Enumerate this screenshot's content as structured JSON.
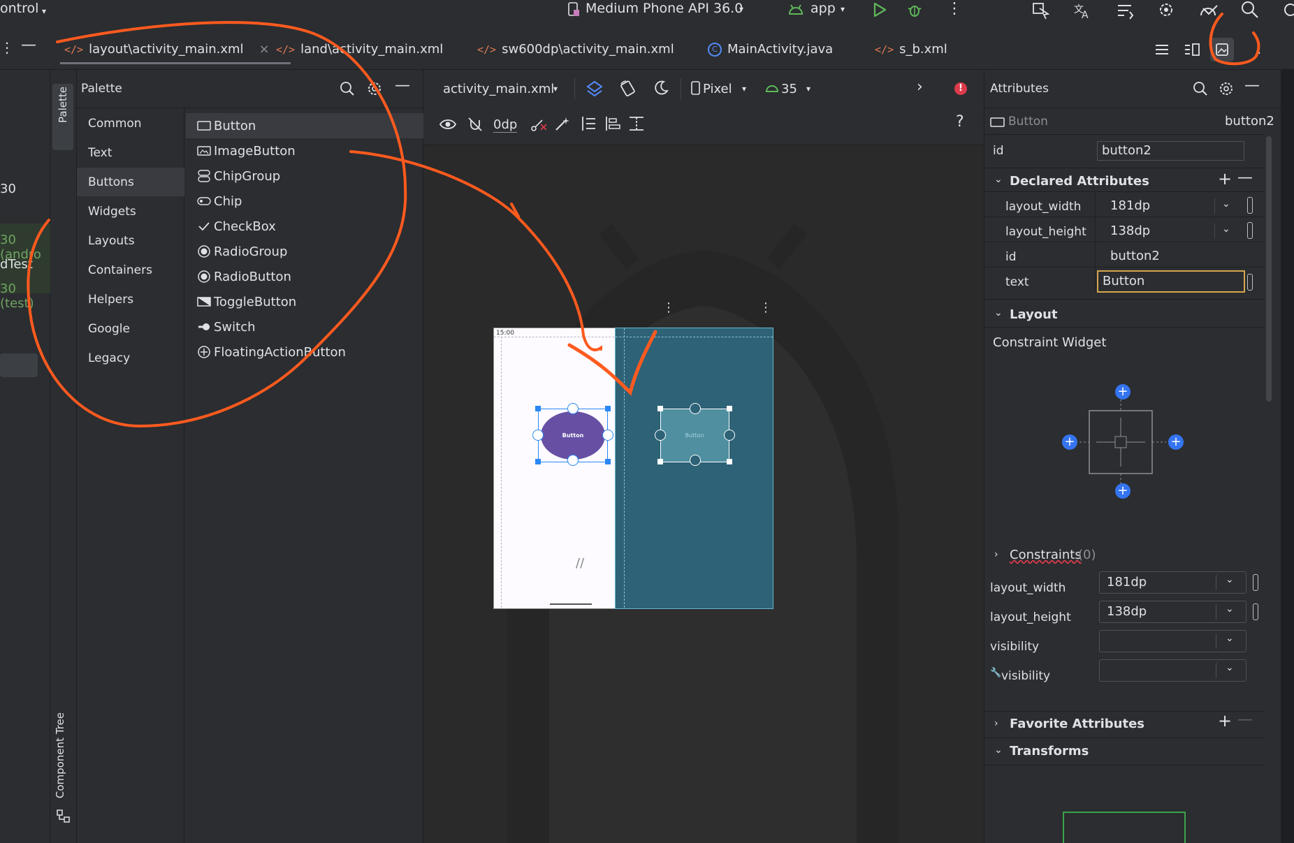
{
  "topbar": {
    "left_text": "ontrol",
    "device": "Medium Phone API 36.0",
    "config": "app"
  },
  "tabs": [
    {
      "label": "layout\\activity_main.xml",
      "kind": "xml"
    },
    {
      "label": "land\\activity_main.xml",
      "kind": "xml"
    },
    {
      "label": "sw600dp\\activity_main.xml",
      "kind": "xml"
    },
    {
      "label": "MainActivity.java",
      "kind": "java"
    },
    {
      "label": "s_b.xml",
      "kind": "xml"
    }
  ],
  "left_panel": {
    "lines": [
      "30",
      "30 (andro",
      "dTest",
      "30 (test)"
    ]
  },
  "side_tabs": {
    "palette": "Palette",
    "component_tree": "Component Tree"
  },
  "palette": {
    "title": "Palette",
    "categories": [
      "Common",
      "Text",
      "Buttons",
      "Widgets",
      "Layouts",
      "Containers",
      "Helpers",
      "Google",
      "Legacy"
    ],
    "selected_category": "Buttons",
    "widgets": [
      "Button",
      "ImageButton",
      "ChipGroup",
      "Chip",
      "CheckBox",
      "RadioGroup",
      "RadioButton",
      "ToggleButton",
      "Switch",
      "FloatingActionButton"
    ]
  },
  "design_toolbar": {
    "file": "activity_main.xml",
    "device": "Pixel",
    "api": "35",
    "margin": "0dp",
    "help": "?"
  },
  "preview": {
    "status_time": "15:00",
    "button_text": "Button",
    "blueprint_button_text": "Button"
  },
  "attributes": {
    "title": "Attributes",
    "widget_type": "Button",
    "widget_id": "button2",
    "id_label": "id",
    "id_value": "button2",
    "declared_title": "Declared Attributes",
    "declared": [
      {
        "name": "layout_width",
        "value": "181dp"
      },
      {
        "name": "layout_height",
        "value": "138dp"
      },
      {
        "name": "id",
        "value": "button2"
      },
      {
        "name": "text",
        "value": "Button"
      }
    ],
    "layout_title": "Layout",
    "constraint_widget": "Constraint Widget",
    "constraints_label": "Constraints",
    "constraints_count": "(0)",
    "layout_fields": [
      {
        "name": "layout_width",
        "value": "181dp"
      },
      {
        "name": "layout_height",
        "value": "138dp"
      },
      {
        "name": "visibility",
        "value": ""
      },
      {
        "name": "visibility",
        "value": ""
      }
    ],
    "favorite_title": "Favorite Attributes",
    "transforms_title": "Transforms"
  },
  "colors": {
    "accent_orange": "#ff5a1f",
    "button_purple": "#6750a4",
    "blueprint": "#2d6277",
    "selection_blue": "#2a87f5"
  }
}
